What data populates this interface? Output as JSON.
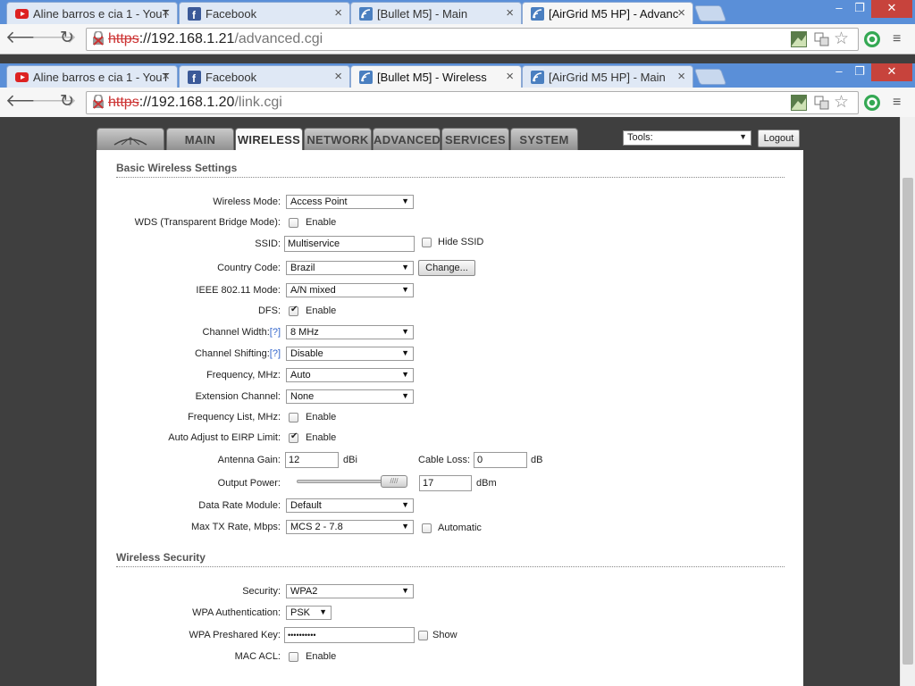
{
  "window1": {
    "tabs": [
      {
        "label": "Aline barros e cia 1 - YouT",
        "icon": "youtube-icon"
      },
      {
        "label": "Facebook",
        "icon": "facebook-icon"
      },
      {
        "label": "[Bullet M5] - Main",
        "icon": "airos-icon"
      },
      {
        "label": "[AirGrid M5 HP] - Advanc",
        "icon": "airos-icon"
      }
    ],
    "url_scheme": "https",
    "url_host": "://192.168.1.21",
    "url_path": "/advanced.cgi"
  },
  "window2": {
    "tabs": [
      {
        "label": "Aline barros e cia 1 - YouT",
        "icon": "youtube-icon"
      },
      {
        "label": "Facebook",
        "icon": "facebook-icon"
      },
      {
        "label": "[Bullet M5] - Wireless",
        "icon": "airos-icon"
      },
      {
        "label": "[AirGrid M5 HP] - Main",
        "icon": "airos-icon"
      }
    ],
    "url_scheme": "https",
    "url_host": "://192.168.1.20",
    "url_path": "/link.cgi"
  },
  "nav": {
    "tabs": [
      "MAIN",
      "WIRELESS",
      "NETWORK",
      "ADVANCED",
      "SERVICES",
      "SYSTEM"
    ],
    "active": "WIRELESS",
    "tools_value": "Tools:",
    "logout_label": "Logout"
  },
  "basic": {
    "title": "Basic Wireless Settings",
    "wireless_mode": {
      "label": "Wireless Mode:",
      "value": "Access Point"
    },
    "wds": {
      "label": "WDS (Transparent Bridge Mode):",
      "option": "Enable",
      "checked": false
    },
    "ssid": {
      "label": "SSID:",
      "value": "Multiservice",
      "hide_label": "Hide SSID"
    },
    "country": {
      "label": "Country Code:",
      "value": "Brazil",
      "button": "Change..."
    },
    "ieee": {
      "label": "IEEE 802.11 Mode:",
      "value": "A/N mixed"
    },
    "dfs": {
      "label": "DFS:",
      "option": "Enable",
      "checked": true
    },
    "channel_width": {
      "label": "Channel Width:",
      "help": "[?]",
      "value": "8 MHz"
    },
    "channel_shifting": {
      "label": "Channel Shifting:",
      "help": "[?]",
      "value": "Disable"
    },
    "frequency": {
      "label": "Frequency, MHz:",
      "value": "Auto"
    },
    "extension": {
      "label": "Extension Channel:",
      "value": "None"
    },
    "freq_list": {
      "label": "Frequency List, MHz:",
      "option": "Enable",
      "checked": false
    },
    "eirp": {
      "label": "Auto Adjust to EIRP Limit:",
      "option": "Enable",
      "checked": true
    },
    "antenna_gain": {
      "label": "Antenna Gain:",
      "value": "12",
      "unit": "dBi"
    },
    "cable_loss": {
      "label": "Cable Loss:",
      "value": "0",
      "unit": "dB"
    },
    "output_power": {
      "label": "Output Power:",
      "value": "17",
      "unit": "dBm",
      "level": 0.9
    },
    "data_rate": {
      "label": "Data Rate Module:",
      "value": "Default"
    },
    "max_tx": {
      "label": "Max TX Rate, Mbps:",
      "value": "MCS 2 - 7.8",
      "auto_label": "Automatic"
    }
  },
  "security": {
    "title": "Wireless Security",
    "security": {
      "label": "Security:",
      "value": "WPA2"
    },
    "wpa_auth": {
      "label": "WPA Authentication:",
      "value": "PSK"
    },
    "wpa_key": {
      "label": "WPA Preshared Key:",
      "value": "••••••••••",
      "show_label": "Show"
    },
    "mac_acl": {
      "label": "MAC ACL:",
      "option": "Enable",
      "checked": false
    }
  }
}
